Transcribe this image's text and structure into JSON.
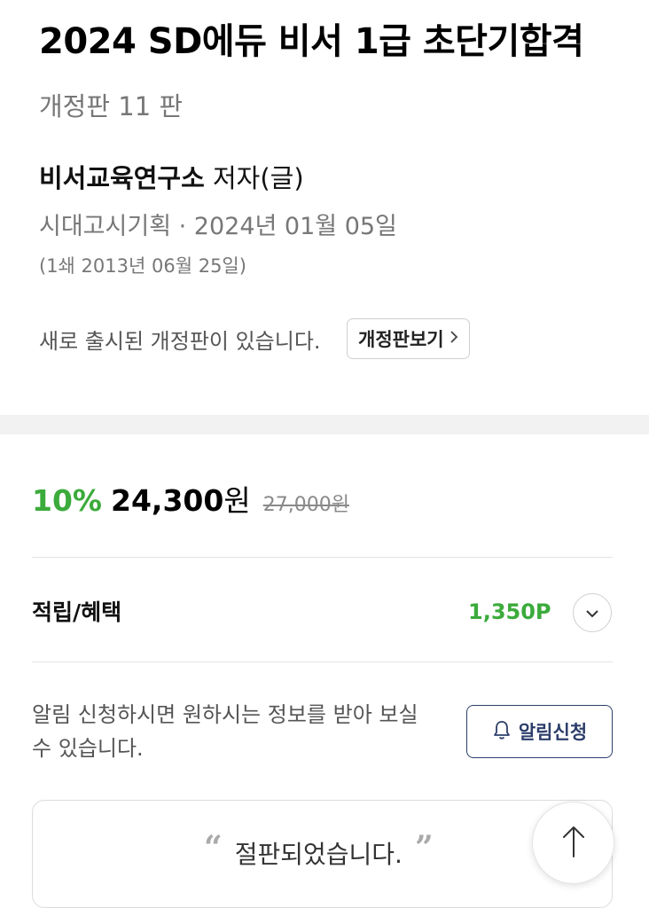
{
  "book": {
    "title": "2024 SD에듀 비서 1급 초단기합격",
    "edition": "개정판 11 판",
    "author_name": "비서교육연구소",
    "author_role": " 저자(글)",
    "publish_info": "시대고시기획 · 2024년 01월 05일",
    "first_print": "(1쇄 2013년 06월 25일)"
  },
  "revision": {
    "notice": "새로 출시된 개정판이 있습니다.",
    "button_label": "개정판보기",
    "button_icon": "chevron-right-icon"
  },
  "price": {
    "discount": "10%",
    "sale_amount": "24,300",
    "sale_unit": "원",
    "original": "27,000원"
  },
  "points": {
    "label": "적립/혜택",
    "value": "1,350P",
    "expand_icon": "chevron-down-icon"
  },
  "alarm": {
    "notice": "알림 신청하시면 원하시는 정보를 받아 보실 수 있습니다.",
    "button_label": "알림신청",
    "button_icon": "bell-icon"
  },
  "status": {
    "open_quote": "“",
    "message": "절판되었습니다.",
    "close_quote": "”"
  },
  "scroll_top": {
    "icon": "arrow-up-icon"
  },
  "colors": {
    "accent_green": "#3bab3b",
    "navy": "#2d3e6b",
    "muted_text": "#777777"
  }
}
